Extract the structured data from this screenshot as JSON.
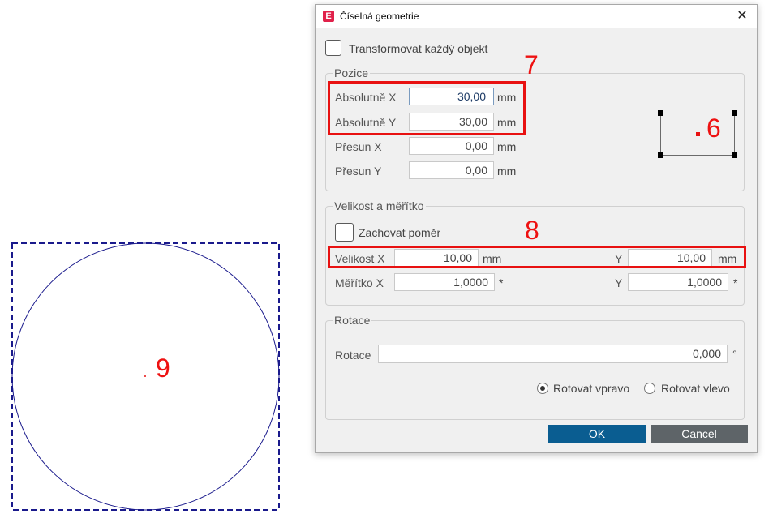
{
  "dialog": {
    "title": "Číselná geometrie",
    "app_icon_letter": "E",
    "close_glyph": "✕",
    "transform_each_label": "Transformovat každý objekt",
    "position": {
      "legend": "Pozice",
      "abs_x_label": "Absolutně X",
      "abs_x_value": "30,00",
      "abs_x_unit": "mm",
      "abs_y_label": "Absolutně Y",
      "abs_y_value": "30,00",
      "abs_y_unit": "mm",
      "move_x_label": "Přesun X",
      "move_x_value": "0,00",
      "move_x_unit": "mm",
      "move_y_label": "Přesun Y",
      "move_y_value": "0,00",
      "move_y_unit": "mm"
    },
    "size": {
      "legend": "Velikost a měřítko",
      "keep_ratio_label": "Zachovat poměr",
      "size_x_label": "Velikost X",
      "size_x_value": "10,00",
      "size_x_unit": "mm",
      "size_y_label": "Y",
      "size_y_value": "10,00",
      "size_y_unit": "mm",
      "scale_x_label": "Měřítko X",
      "scale_x_value": "1,0000",
      "scale_x_unit": "*",
      "scale_y_label": "Y",
      "scale_y_value": "1,0000",
      "scale_y_unit": "*"
    },
    "rotation": {
      "legend": "Rotace",
      "label": "Rotace",
      "value": "0,000",
      "unit": "°",
      "cw_label": "Rotovat vpravo",
      "ccw_label": "Rotovat vlevo",
      "selected": "cw"
    },
    "ok_label": "OK",
    "cancel_label": "Cancel"
  },
  "annotations": {
    "a6": "6",
    "a7": "7",
    "a8": "8",
    "a9": "9"
  },
  "colors": {
    "annotation": "#e81111",
    "shape_stroke": "#1a1a8c",
    "ok_button": "#0a5d91",
    "cancel_button": "#5e6468"
  }
}
